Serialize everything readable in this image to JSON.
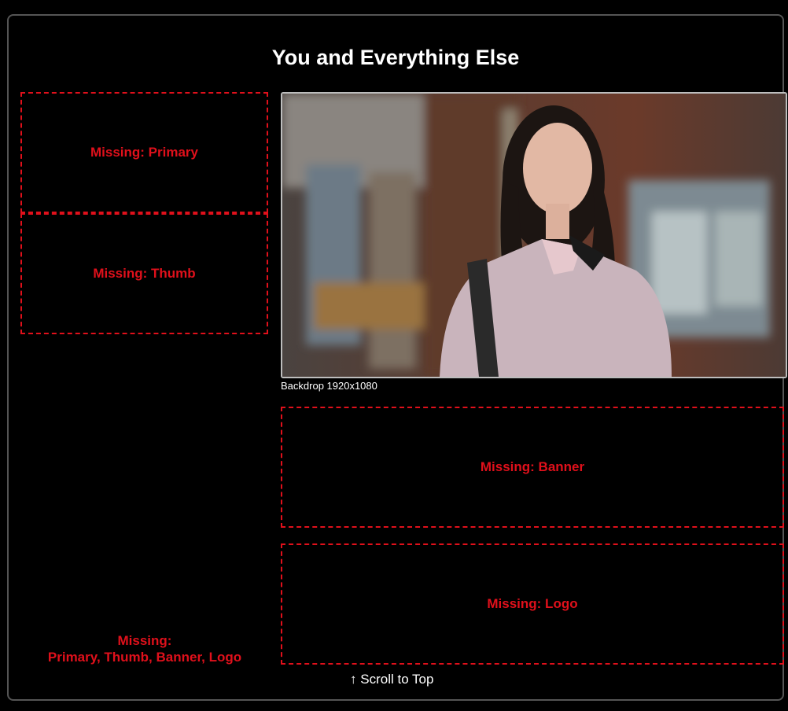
{
  "page": {
    "title": "You and Everything Else"
  },
  "missing_boxes": {
    "primary": "Missing: Primary",
    "thumb": "Missing: Thumb",
    "banner": "Missing: Banner",
    "logo": "Missing: Logo"
  },
  "backdrop": {
    "caption": "Backdrop 1920x1080"
  },
  "summary": {
    "heading": "Missing:",
    "list": "Primary, Thumb, Banner, Logo"
  },
  "footer": {
    "scroll_arrow": "↑",
    "scroll_label": "Scroll to Top"
  },
  "colors": {
    "background": "#000000",
    "missing_red": "#e0101b",
    "border": "#555555"
  }
}
